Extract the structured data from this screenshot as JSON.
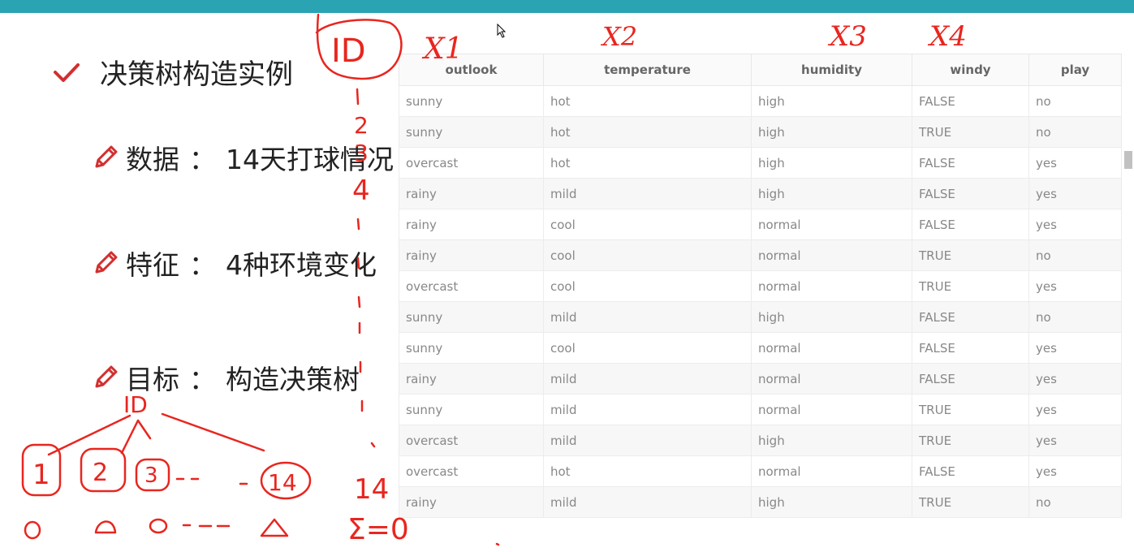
{
  "slide": {
    "title": "决策树构造实例",
    "bullets": [
      {
        "label": "数据",
        "text": "14天打球情况"
      },
      {
        "label": "特征",
        "text": "4种环境变化"
      },
      {
        "label": "目标",
        "text": "构造决策树"
      }
    ],
    "colon": "："
  },
  "table": {
    "headers": [
      "outlook",
      "temperature",
      "humidity",
      "windy",
      "play"
    ],
    "rows": [
      [
        "sunny",
        "hot",
        "high",
        "FALSE",
        "no"
      ],
      [
        "sunny",
        "hot",
        "high",
        "TRUE",
        "no"
      ],
      [
        "overcast",
        "hot",
        "high",
        "FALSE",
        "yes"
      ],
      [
        "rainy",
        "mild",
        "high",
        "FALSE",
        "yes"
      ],
      [
        "rainy",
        "cool",
        "normal",
        "FALSE",
        "yes"
      ],
      [
        "rainy",
        "cool",
        "normal",
        "TRUE",
        "no"
      ],
      [
        "overcast",
        "cool",
        "normal",
        "TRUE",
        "yes"
      ],
      [
        "sunny",
        "mild",
        "high",
        "FALSE",
        "no"
      ],
      [
        "sunny",
        "cool",
        "normal",
        "FALSE",
        "yes"
      ],
      [
        "rainy",
        "mild",
        "normal",
        "FALSE",
        "yes"
      ],
      [
        "sunny",
        "mild",
        "normal",
        "TRUE",
        "yes"
      ],
      [
        "overcast",
        "mild",
        "high",
        "TRUE",
        "yes"
      ],
      [
        "overcast",
        "hot",
        "normal",
        "FALSE",
        "yes"
      ],
      [
        "rainy",
        "mild",
        "high",
        "TRUE",
        "no"
      ]
    ]
  },
  "handwriting": {
    "id_label": "ID",
    "feature_labels": [
      "X1",
      "X2",
      "X3",
      "X4"
    ],
    "id_numbers": [
      "1",
      "2",
      "3",
      "4",
      "14"
    ],
    "tree_root": "ID",
    "tree_leaves": [
      "1",
      "2",
      "3",
      "14"
    ],
    "sum_text": "Σ=0"
  },
  "colors": {
    "accent": "#2aa3b3",
    "ink": "#e8261f",
    "icon_red": "#d32f2f"
  }
}
